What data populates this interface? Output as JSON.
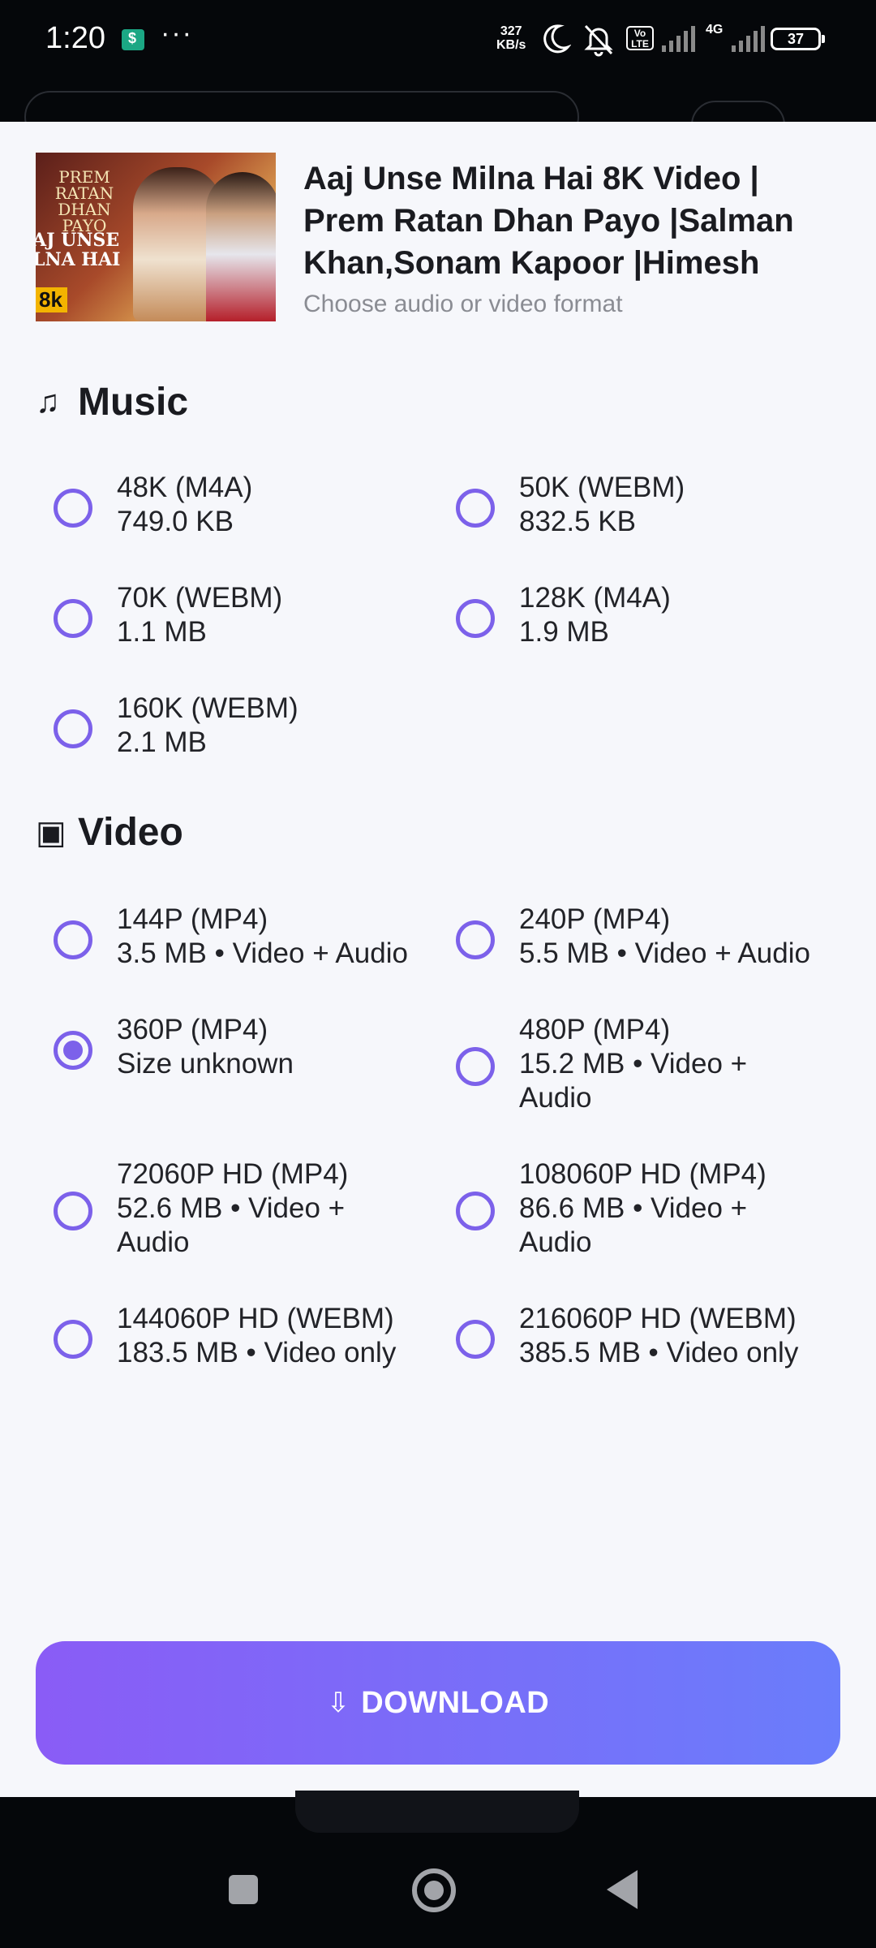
{
  "status_bar": {
    "time": "1:20",
    "dots": "···",
    "speed_value": "327",
    "speed_unit": "KB/s",
    "volte_top": "Vo",
    "volte_bottom": "LTE",
    "network": "4G",
    "battery": "37"
  },
  "header": {
    "title": "Aaj Unse Milna Hai 8K Video | Prem Ratan Dhan Payo |Salman Khan,Sonam Kapoor |Himesh",
    "subtitle": "Choose audio or video format",
    "thumbnail": {
      "film_title": "PREM RATAN DHAN PAYO",
      "song_text": "AJ UNSE\nLNA HAI",
      "badge": "8k"
    }
  },
  "music": {
    "icon": "music-note-icon",
    "label": "Music",
    "options": [
      {
        "format": "48K (M4A)",
        "detail": "749.0 KB",
        "selected": false
      },
      {
        "format": "50K (WEBM)",
        "detail": "832.5 KB",
        "selected": false
      },
      {
        "format": "70K (WEBM)",
        "detail": "1.1 MB",
        "selected": false
      },
      {
        "format": "128K (M4A)",
        "detail": "1.9 MB",
        "selected": false
      },
      {
        "format": "160K (WEBM)",
        "detail": "2.1 MB",
        "selected": false
      }
    ]
  },
  "video": {
    "icon": "video-frame-icon",
    "label": "Video",
    "options": [
      {
        "format": "144P (MP4)",
        "detail": "3.5 MB • Video + Audio",
        "selected": false
      },
      {
        "format": "240P (MP4)",
        "detail": "5.5 MB • Video + Audio",
        "selected": false
      },
      {
        "format": "360P (MP4)",
        "detail": "Size unknown",
        "selected": true
      },
      {
        "format": "480P (MP4)",
        "detail": "15.2 MB • Video + Audio",
        "selected": false
      },
      {
        "format": "72060P HD (MP4)",
        "detail": "52.6 MB • Video + Audio",
        "selected": false
      },
      {
        "format": "108060P HD (MP4)",
        "detail": "86.6 MB • Video + Audio",
        "selected": false
      },
      {
        "format": "144060P HD (WEBM)",
        "detail": "183.5 MB • Video only",
        "selected": false
      },
      {
        "format": "216060P HD (WEBM)",
        "detail": "385.5 MB • Video only",
        "selected": false
      }
    ]
  },
  "download": {
    "icon": "⇩",
    "label": "DOWNLOAD"
  },
  "colors": {
    "accent": "#7c61ea",
    "button_gradient_start": "#8a5cf6",
    "button_gradient_end": "#6a7dfb"
  }
}
